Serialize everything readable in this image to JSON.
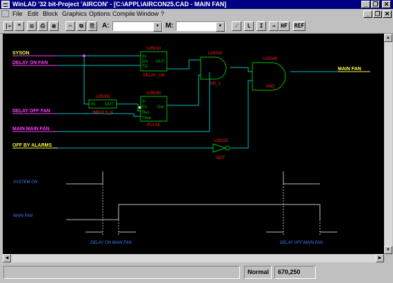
{
  "window": {
    "title": "WinLAD '32 bit-Project 'AIRCON' - [C:\\APPL\\AIRCON25.CAD - MAIN FAN]"
  },
  "window_controls": {
    "minimize": "_",
    "restore": "❐",
    "close": "✕"
  },
  "doc_controls": {
    "minimize": "_",
    "restore": "❐",
    "close": "✕"
  },
  "menu": {
    "items": [
      "File",
      "Edit",
      "Block",
      "Graphics",
      "Options",
      "Compile",
      "Window",
      "?"
    ]
  },
  "toolbar": {
    "buttons": [
      "|←",
      "*",
      "▤",
      "⎙",
      "▦",
      "✂",
      "⧉",
      "⎘"
    ],
    "combo_a_label": "A:",
    "combo_a_value": "",
    "combo_m_label": "M:",
    "combo_m_value": "",
    "tool_buttons": [
      "⁄",
      "L",
      "I",
      "→",
      "HF",
      "REF"
    ]
  },
  "diagram": {
    "signals": {
      "syson": "SYSON",
      "delay_on_fan": "DELAY ON FAN",
      "delay_off_fan": "DELAY OFF FAN",
      "main_main_fan": "MAIN MAIN FAN",
      "off_by_alarms": "OFF BY ALARMS",
      "main_fan": "MAIN FAN"
    },
    "blocks": {
      "timer_on": {
        "id": "U25010",
        "pins_in": [
          "IN",
          "EN",
          "TO"
        ],
        "pin_out": "OUT",
        "tag": "DELAY_ON"
      },
      "not_inv": {
        "id": "U25005",
        "pin_in": "IN",
        "pin_out": "OUT",
        "tag": "IMPULS_N"
      },
      "pulse": {
        "id": "U25030",
        "pins_in": [
          "In",
          "En",
          "Res",
          "Time"
        ],
        "pin_out": "Out",
        "tag": "PULSE"
      },
      "and_1": {
        "id": "U25020",
        "tag": "OR_1"
      },
      "and_2": {
        "id": "U25040",
        "tag": "AND"
      },
      "not_alarm": {
        "id": "U25025",
        "tag": "NOT"
      }
    },
    "timing": {
      "row_system_on": "SYSTEM ON",
      "row_main_fan": "MAIN FAN",
      "delay_on_label": "DELAY ON MAIN FAN",
      "delay_off_label": "DELAY OFF MAIN FAN"
    }
  },
  "scrollbars": {
    "up": "▲",
    "down": "▼",
    "left": "◀",
    "right": "▶"
  },
  "statusbar": {
    "message": "",
    "mode": "Normal",
    "coords": "670,250"
  },
  "colors": {
    "canvas_bg": "#000000",
    "wire": "#00c0c0",
    "label_yellow": "#ffff40",
    "label_magenta": "#ff40ff",
    "block_green": "#00c000",
    "block_red": "#ff2020",
    "timing_white": "#c0c0c0",
    "timing_text": "#4080ff",
    "titlebar": "#000080"
  }
}
